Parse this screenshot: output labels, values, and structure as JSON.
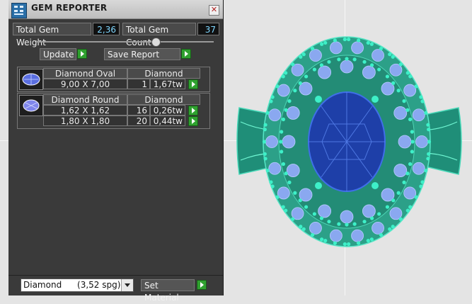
{
  "window": {
    "title": "GEM REPORTER",
    "close_label": "✕"
  },
  "summary": {
    "weight_label": "Total Gem Weight",
    "weight_value": "2,36",
    "count_label": "Total Gem Count",
    "count_value": "37"
  },
  "actions": {
    "update_label": "Update",
    "save_label": "Save Report"
  },
  "groups": [
    {
      "shape": "Diamond Oval",
      "material": "Diamond",
      "rows": [
        {
          "size": "9,00 X 7,00",
          "count": "1",
          "weight": "1,67tw"
        }
      ]
    },
    {
      "shape": "Diamond Round",
      "material": "Diamond",
      "rows": [
        {
          "size": "1,62 X 1,62",
          "count": "16",
          "weight": "0,26tw"
        },
        {
          "size": "1,80 X 1,80",
          "count": "20",
          "weight": "0,44tw"
        }
      ]
    }
  ],
  "footer": {
    "material_name": "Diamond",
    "material_spg": "(3,52 spg)",
    "set_material_label": "Set Material"
  },
  "colors": {
    "gem_blue": "#1e3fa8",
    "small_stone": "#8aa8f0",
    "prong": "#3ef0c8",
    "metal": "#2fa690"
  }
}
